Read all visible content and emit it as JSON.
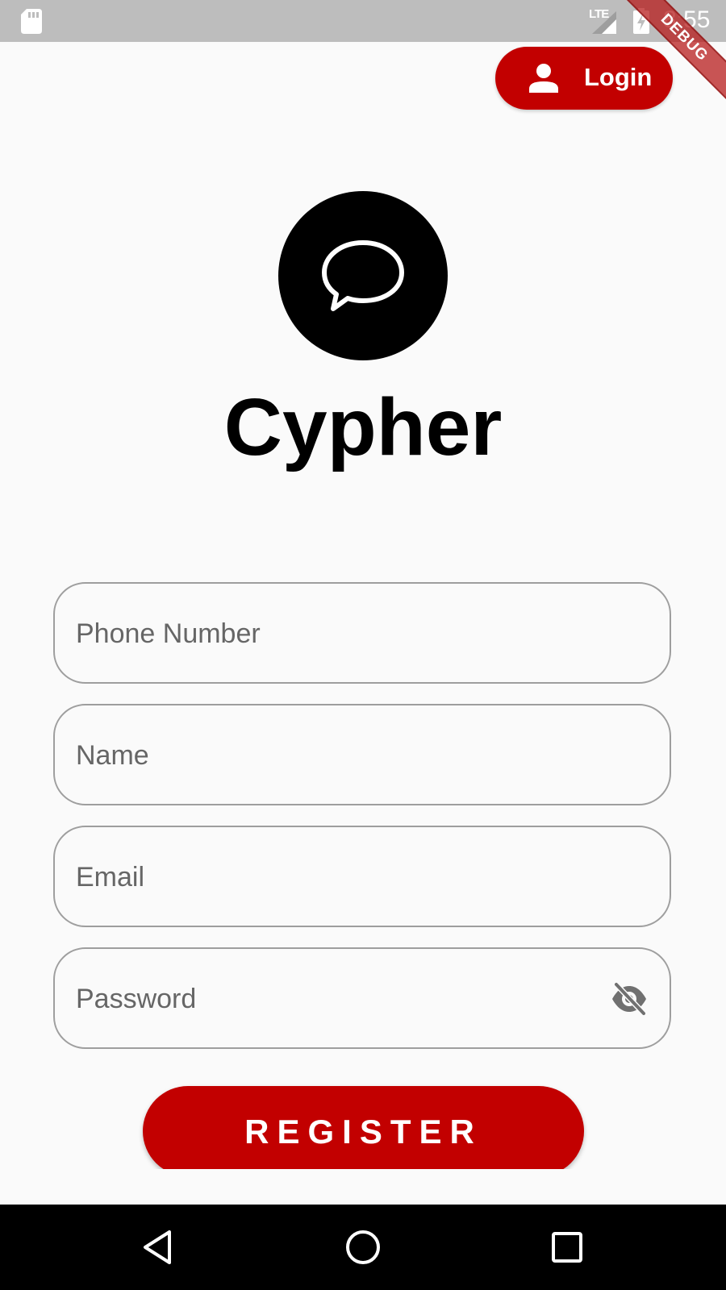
{
  "status_bar": {
    "network_label": "LTE",
    "time": "8:55",
    "debug_banner": "DEBUG"
  },
  "header": {
    "login_label": "Login",
    "login_icon": "person-icon"
  },
  "branding": {
    "logo_icon": "chat-bubble-icon",
    "app_name": "Cypher"
  },
  "form": {
    "phone": {
      "placeholder": "Phone Number",
      "value": ""
    },
    "name": {
      "placeholder": "Name",
      "value": ""
    },
    "email": {
      "placeholder": "Email",
      "value": ""
    },
    "password": {
      "placeholder": "Password",
      "value": "",
      "visibility_icon": "eye-off-icon"
    },
    "register_label": "REGISTER"
  },
  "colors": {
    "accent": "#c20000",
    "background": "#fafafa",
    "status_bar": "#bdbdbd",
    "field_border": "#9e9e9e"
  },
  "nav_bar": {
    "icons": [
      "back-icon",
      "home-icon",
      "recents-icon"
    ]
  }
}
